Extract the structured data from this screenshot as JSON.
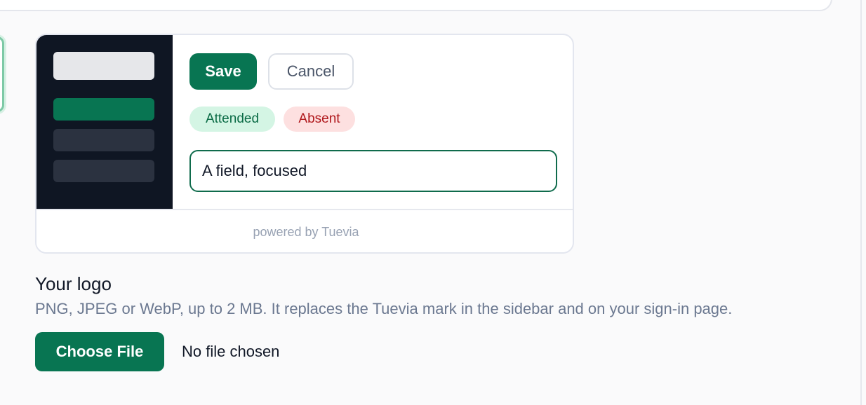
{
  "preview": {
    "save_label": "Save",
    "cancel_label": "Cancel",
    "badges": {
      "attended": "Attended",
      "absent": "Absent"
    },
    "field_value": "A field, focused",
    "footer_text": "powered by Tuevia"
  },
  "logo_section": {
    "title": "Your logo",
    "help_text": "PNG, JPEG or WebP, up to 2 MB. It replaces the Tuevia mark in the sidebar and on your sign-in page.",
    "choose_file_label": "Choose File",
    "file_status": "No file chosen"
  },
  "colors": {
    "brand": "#087552",
    "sidebar_dark": "#0f1623",
    "attended_bg": "#d4f5e4",
    "absent_bg": "#fde0e0"
  }
}
